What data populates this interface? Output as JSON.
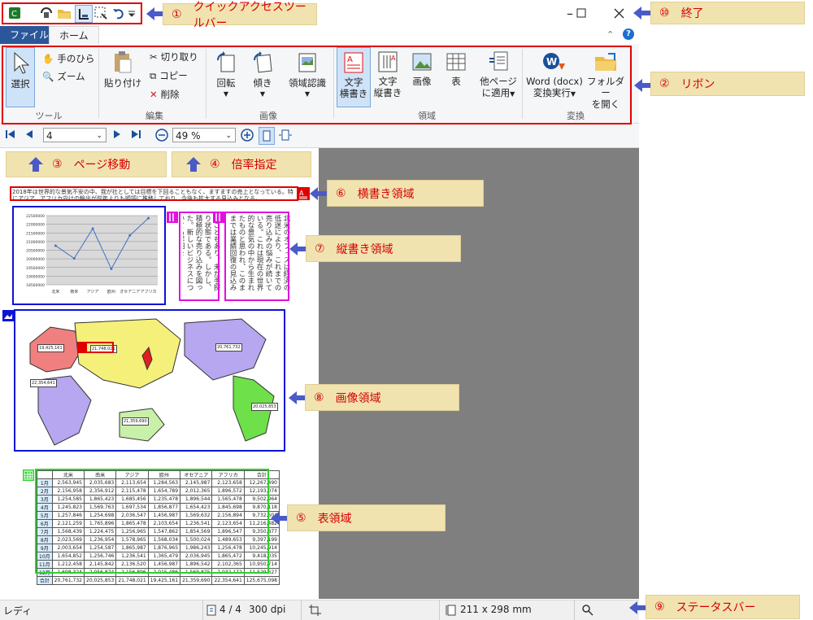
{
  "app": {
    "tabs": [
      "ファイル",
      "ホーム"
    ],
    "window_controls": [
      "minimize",
      "maximize",
      "close"
    ]
  },
  "ribbon": {
    "groups": {
      "tool": "ツール",
      "edit": "編集",
      "image": "画像",
      "region": "領域",
      "convert": "変換"
    },
    "select": "選択",
    "hand": "手のひら",
    "zoom": "ズーム",
    "paste": "貼り付け",
    "cut": "切り取り",
    "copy": "コピー",
    "delete": "削除",
    "rotate": "回転",
    "tilt": "傾き",
    "region_recognition": "領域認識",
    "text_horizontal": [
      "文字",
      "横書き"
    ],
    "text_vertical": [
      "文字",
      "縦書き"
    ],
    "image_region": "画像",
    "table_region": "表",
    "apply_other": [
      "他ページ",
      "に適用"
    ],
    "word_convert": [
      "Word (docx)",
      "変換実行"
    ],
    "open_folder": [
      "フォルダー",
      "を開く"
    ]
  },
  "nav": {
    "page": "4",
    "zoom": "49 %"
  },
  "status": {
    "ready": "レディ",
    "page_count": "4 / 4",
    "dpi": "300 dpi",
    "size": "211 x 298 mm"
  },
  "callouts": {
    "c1": {
      "num": "①",
      "label": "クイックアクセスツールバー"
    },
    "c2": {
      "num": "②",
      "label": "リボン"
    },
    "c3": {
      "num": "③",
      "label": "ページ移動"
    },
    "c4": {
      "num": "④",
      "label": "倍率指定"
    },
    "c5": {
      "num": "⑤",
      "label": "表領域"
    },
    "c6": {
      "num": "⑥",
      "label": "横書き領域"
    },
    "c7": {
      "num": "⑦",
      "label": "縦書き領域"
    },
    "c8": {
      "num": "⑧",
      "label": "画像領域"
    },
    "c9": {
      "num": "⑨",
      "label": "ステータスバー"
    },
    "c10": {
      "num": "⑩",
      "label": "終了"
    }
  },
  "document": {
    "paragraph": "2018年は世界的な景気不安の中、我が社としては目標を下回ることもなく、ますますの売上となっている。特にアジア、アフリカ向けの輸出が前年よりも順調に推移しており、今後も拡大する見込みとなる。",
    "vertical_text_1": "ることもあり、未だ手探り状態である。しかし、積極的な売り込みを図った。新しいビジネスについても詳細を",
    "vertical_text_2": "北米のオフィスは経済の低迷により、これまでの売り込みの悩みが続いている。これは現在の世界的な景気の中から生まれたものと思われ、このままでは業績回復の見込みがないため、抜本的な対策を急いで検討することとなった。販売ルートや製品の情報などを含めて、担当者レベルでの情報共有を現在よりも密にするように心がける。",
    "map_labels": [
      "19,425,161",
      "21,748,021",
      "20,761,732",
      "22,354,641",
      "20,025,853",
      "21,359,690"
    ]
  },
  "chart_data": {
    "type": "line",
    "categories": [
      "北米",
      "南米",
      "アジア",
      "欧州",
      "オセアニア",
      "アフリカ"
    ],
    "series": [
      {
        "values": [
          20761732,
          20025853,
          21748021,
          19425161,
          21359690,
          22354641
        ]
      }
    ],
    "yticks": [
      "22500000",
      "22000000",
      "21500000",
      "21000000",
      "20500000",
      "20000000",
      "19500000",
      "19000000",
      "18500000"
    ],
    "ylim": [
      18500000,
      22500000
    ],
    "grid": true
  },
  "table": {
    "headers": [
      "",
      "北米",
      "南米",
      "アジア",
      "欧州",
      "オセアニア",
      "アフリカ",
      "合計"
    ],
    "rows": [
      [
        "1月",
        "2,563,945",
        "2,035,683",
        "2,113,654",
        "1,284,563",
        "2,145,987",
        "2,123,658",
        "12,267,490"
      ],
      [
        "2月",
        "2,156,958",
        "2,356,912",
        "2,115,478",
        "1,654,789",
        "2,012,365",
        "1,896,572",
        "12,193,074"
      ],
      [
        "3月",
        "1,254,585",
        "1,865,423",
        "1,685,456",
        "1,235,478",
        "1,896,544",
        "1,565,478",
        "9,502,964"
      ],
      [
        "4月",
        "1,245,823",
        "1,569,763",
        "1,697,534",
        "1,856,877",
        "1,654,423",
        "1,845,698",
        "9,870,118"
      ],
      [
        "5月",
        "1,257,846",
        "1,254,698",
        "2,036,547",
        "1,456,987",
        "1,569,632",
        "2,156,894",
        "9,732,604"
      ],
      [
        "6月",
        "2,121,259",
        "1,765,896",
        "1,865,478",
        "2,103,654",
        "1,236,541",
        "2,123,654",
        "11,216,482"
      ],
      [
        "7月",
        "1,568,439",
        "1,224,475",
        "1,256,965",
        "1,547,862",
        "1,854,569",
        "1,896,547",
        "9,350,877"
      ],
      [
        "8月",
        "2,023,569",
        "1,236,954",
        "1,578,965",
        "1,568,034",
        "1,500,024",
        "1,489,653",
        "9,397,199"
      ],
      [
        "9月",
        "2,003,654",
        "1,254,587",
        "1,865,987",
        "1,876,965",
        "1,986,243",
        "1,256,478",
        "10,245,914"
      ],
      [
        "10月",
        "1,654,852",
        "1,256,746",
        "1,236,541",
        "1,365,479",
        "2,036,945",
        "1,865,472",
        "9,418,035"
      ],
      [
        "11月",
        "1,212,458",
        "2,145,842",
        "2,136,520",
        "1,456,987",
        "1,896,542",
        "2,102,365",
        "10,950,714"
      ],
      [
        "12月",
        "1,698,324",
        "2,056,874",
        "2,156,896",
        "2,015,486",
        "1,569,875",
        "2,032,172",
        "11,529,627"
      ],
      [
        "合計",
        "20,761,732",
        "20,025,853",
        "21,748,021",
        "19,425,161",
        "21,359,690",
        "22,354,641",
        "125,675,098"
      ]
    ]
  },
  "colors": {
    "accent": "#2b579a",
    "callout_bg": "#f1e3b0",
    "callout_text": "#d40000",
    "annot_red": "#e00000",
    "annot_blue": "#0a14d6",
    "annot_magenta": "#e010e0",
    "annot_green": "#2ed12e"
  }
}
